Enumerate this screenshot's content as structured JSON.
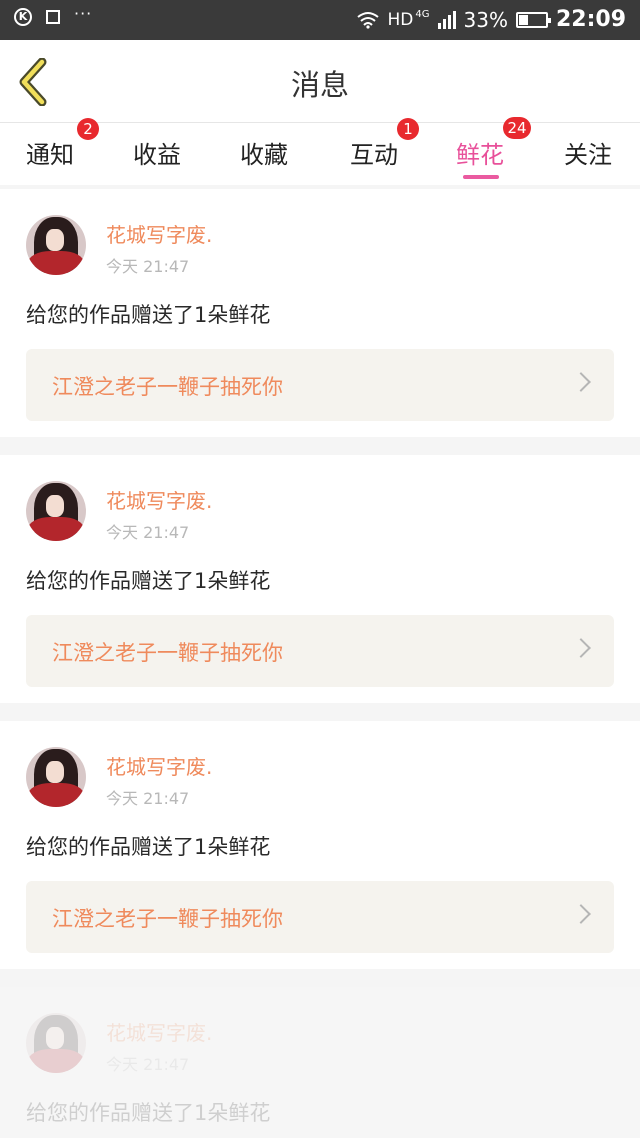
{
  "status_bar": {
    "hd": "HD",
    "network": "4G",
    "battery": "33%",
    "battery_level": 0.33,
    "time": "22:09",
    "dots": "···"
  },
  "header": {
    "title": "消息"
  },
  "tabs": [
    {
      "label": "通知",
      "badge": "2"
    },
    {
      "label": "收益",
      "badge": ""
    },
    {
      "label": "收藏",
      "badge": ""
    },
    {
      "label": "互动",
      "badge": "1"
    },
    {
      "label": "鲜花",
      "badge": "24",
      "active": true
    },
    {
      "label": "关注",
      "badge": ""
    }
  ],
  "colors": {
    "accent": "#e8509a",
    "badge": "#e8292e",
    "orange_text": "#ef8a5c"
  },
  "notifications": [
    {
      "sender": "花城写字废.",
      "time": "今天  21:47",
      "message": "给您的作品赠送了1朵鲜花",
      "work_title": "江澄之老子一鞭子抽死你"
    },
    {
      "sender": "花城写字废.",
      "time": "今天  21:47",
      "message": "给您的作品赠送了1朵鲜花",
      "work_title": "江澄之老子一鞭子抽死你"
    },
    {
      "sender": "花城写字废.",
      "time": "今天  21:47",
      "message": "给您的作品赠送了1朵鲜花",
      "work_title": "江澄之老子一鞭子抽死你"
    },
    {
      "sender": "花城写字废.",
      "time": "今天  21:47",
      "message": "给您的作品赠送了1朵鲜花"
    }
  ]
}
